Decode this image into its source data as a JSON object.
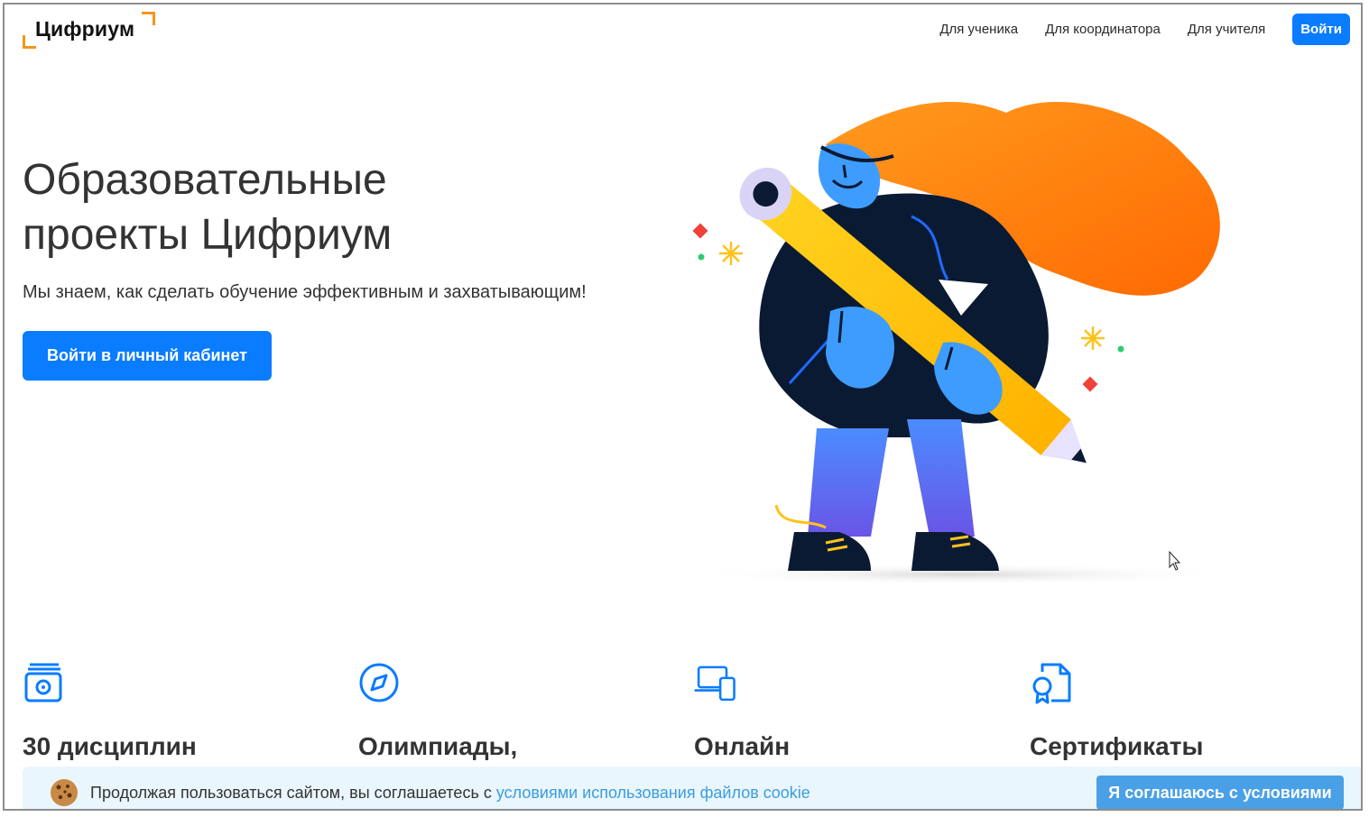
{
  "header": {
    "logo_text": "Цифриум",
    "nav": [
      "Для ученика",
      "Для координатора",
      "Для учителя"
    ],
    "login_label": "Войти"
  },
  "hero": {
    "title_line1": "Образовательные",
    "title_line2": "проекты Цифриум",
    "subtitle": "Мы знаем, как сделать обучение эффективным и захватывающим!",
    "cta_label": "Войти в личный кабинет"
  },
  "features": [
    {
      "title": "30 дисциплин",
      "icon": "disciplines-icon"
    },
    {
      "title": "Олимпиады,",
      "icon": "compass-icon"
    },
    {
      "title": "Онлайн",
      "icon": "devices-icon"
    },
    {
      "title": "Сертификаты",
      "icon": "certificate-icon"
    }
  ],
  "cookie_banner": {
    "text": "Продолжая пользоваться сайтом, вы соглашаетесь с ",
    "link_text": "условиями использования файлов cookie",
    "accept_label": "Я соглашаюсь с условиями"
  },
  "colors": {
    "accent": "#0a7cff",
    "logo_corner": "#f7941d",
    "hair": "#ff7a00",
    "banner_bg": "#eaf6fd",
    "banner_button": "#4aa0e6"
  }
}
